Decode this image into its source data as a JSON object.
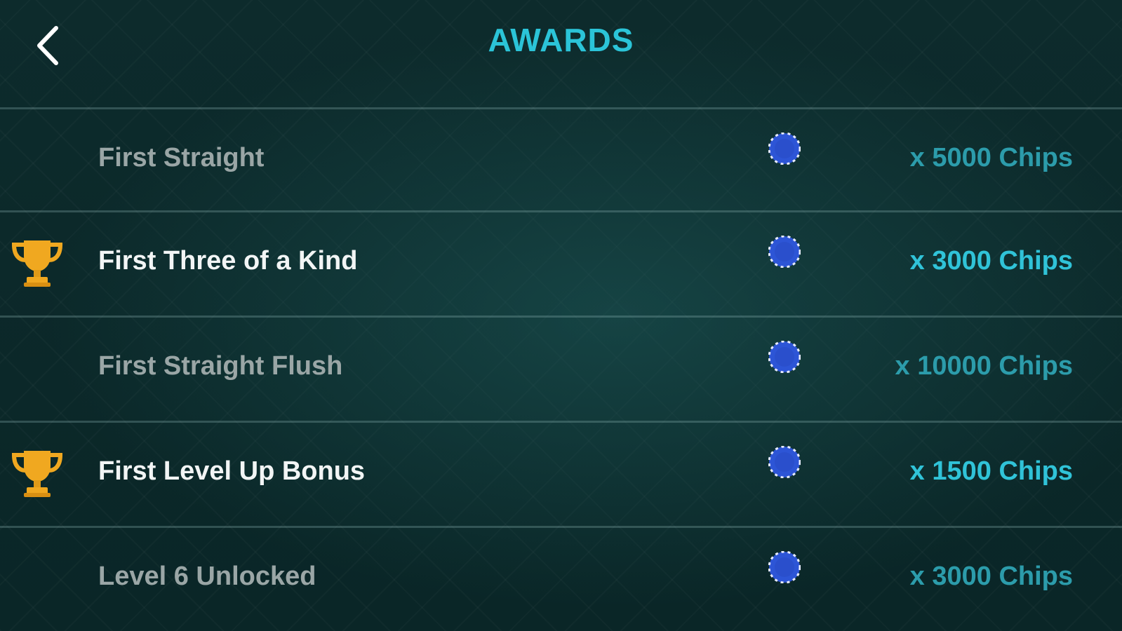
{
  "header": {
    "title": "AWARDS",
    "back_icon": "chevron-left-icon"
  },
  "colors": {
    "title": "#2bc4d8",
    "reward_bright": "#30c3d8",
    "reward_dim": "#2c9cab",
    "trophy": "#f0a820",
    "chip": "#2d55d6"
  },
  "awards": [
    {
      "name": "First Straight",
      "reward": "x 5000 Chips",
      "earned": false
    },
    {
      "name": "First Three of a Kind",
      "reward": "x 3000 Chips",
      "earned": true
    },
    {
      "name": "First Straight Flush",
      "reward": "x 10000 Chips",
      "earned": false
    },
    {
      "name": "First Level Up Bonus",
      "reward": "x 1500 Chips",
      "earned": true
    },
    {
      "name": "Level 6 Unlocked",
      "reward": "x 3000 Chips",
      "earned": false
    }
  ]
}
